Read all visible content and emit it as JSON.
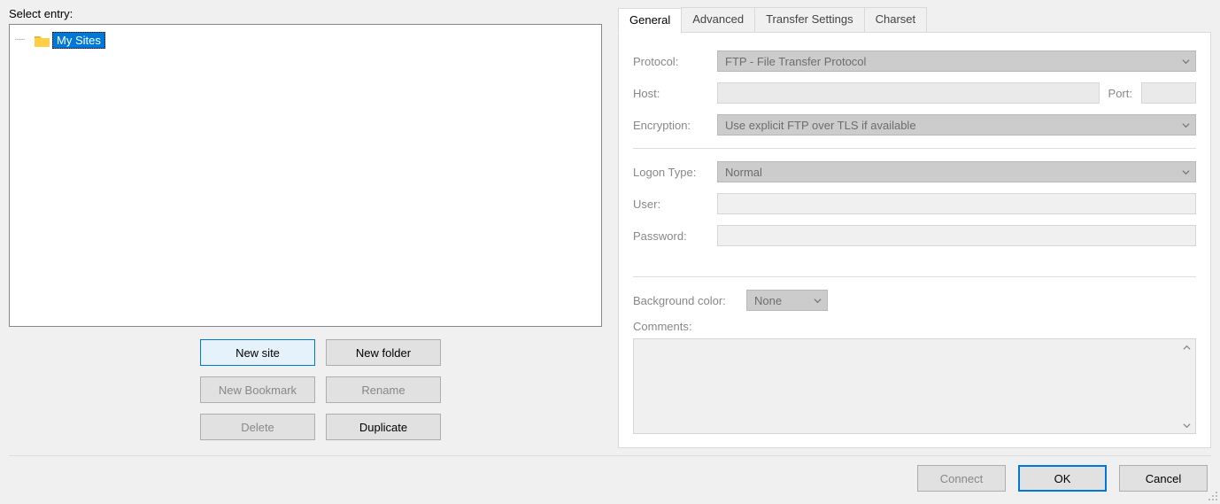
{
  "left": {
    "select_entry_label": "Select entry:",
    "tree_item": "My Sites",
    "buttons": {
      "new_site": "New site",
      "new_folder": "New folder",
      "new_bookmark": "New Bookmark",
      "rename": "Rename",
      "delete": "Delete",
      "duplicate": "Duplicate"
    }
  },
  "tabs": {
    "general": "General",
    "advanced": "Advanced",
    "transfer": "Transfer Settings",
    "charset": "Charset"
  },
  "form": {
    "protocol_label": "Protocol:",
    "protocol_value": "FTP - File Transfer Protocol",
    "host_label": "Host:",
    "port_label": "Port:",
    "encryption_label": "Encryption:",
    "encryption_value": "Use explicit FTP over TLS if available",
    "logon_type_label": "Logon Type:",
    "logon_type_value": "Normal",
    "user_label": "User:",
    "password_label": "Password:",
    "bg_color_label": "Background color:",
    "bg_color_value": "None",
    "comments_label": "Comments:"
  },
  "footer": {
    "connect": "Connect",
    "ok": "OK",
    "cancel": "Cancel"
  }
}
